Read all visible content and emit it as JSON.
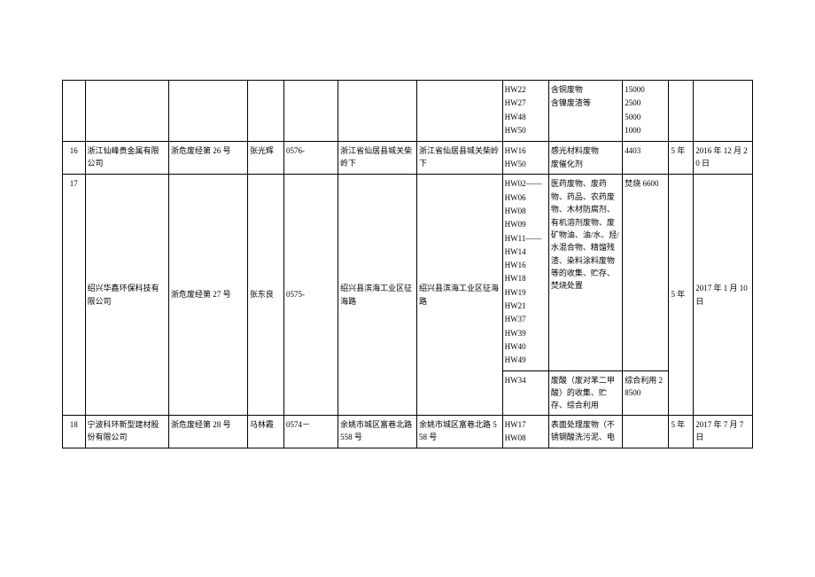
{
  "rows": [
    {
      "idx": "",
      "company": "",
      "permit": "",
      "person": "",
      "phone": "",
      "addr1": "",
      "addr2": "",
      "code_lines": [
        "HW22",
        "HW27",
        "HW48",
        "HW50"
      ],
      "desc_lines": [
        "含铜废物",
        "含镍废渣等"
      ],
      "qty_lines": [
        "15000",
        "2500",
        "5000",
        "1000"
      ],
      "years": "",
      "date": ""
    },
    {
      "idx": "16",
      "company": "浙江仙峰贵金属有限公司",
      "permit": "浙危废经第 26 号",
      "person": "张光辉",
      "phone": "0576-",
      "addr1": "浙江省仙居县城关柴岭下",
      "addr2": "浙江省仙居县城关柴岭下",
      "code_lines": [
        "HW16",
        "HW50"
      ],
      "desc_lines": [
        "感光材料废物",
        "废催化剂"
      ],
      "qty_lines": [
        "4403"
      ],
      "years": "5 年",
      "date": "2016 年 12 月 20 日"
    },
    {
      "idx": "17",
      "company": "绍兴华鑫环保科技有限公司",
      "permit": "浙危废经第 27 号",
      "person": "张东良",
      "phone": "0575-",
      "addr1": "绍兴县滨海工业区征海路",
      "addr2": "绍兴县滨海工业区征海路",
      "sub1": {
        "code_lines": [
          "HW02——",
          "HW06",
          "HW08",
          "HW09",
          "HW11——",
          "HW14",
          "HW16",
          "HW18",
          "HW19",
          "HW21",
          "HW37",
          "HW39",
          "HW40",
          "HW49"
        ],
        "desc_lines": [
          "医药废物、废药物、药品、农药废物、木材防腐剂、有机溶剂废物、废矿物油、油/水、烃/水混合物、精馏残渣、染料涂料废物等的收集、贮存、焚烧处置"
        ],
        "qty": "焚烧 6600"
      },
      "sub2": {
        "code_lines": [
          "HW34"
        ],
        "desc_lines": [
          "废酸（废对苯二甲酸）的收集、贮存、综合利用"
        ],
        "qty": "综合利用 28500"
      },
      "years": "5 年",
      "date": "2017 年 1 月 10 日"
    },
    {
      "idx": "18",
      "company": "宁波科环新型建材股份有限公司",
      "permit": "浙危废经第 28 号",
      "person": "马林霞",
      "phone": "0574－",
      "addr1": "余姚市城区富巷北路 558 号",
      "addr2": "余姚市城区富巷北路 558 号",
      "code_lines": [
        "HW17",
        "HW08"
      ],
      "desc_lines": [
        "表面处理废物（不锈钢酸洗污泥、电"
      ],
      "qty_lines": [],
      "years": "5 年",
      "date": "2017 年 7 月 7 日"
    }
  ]
}
